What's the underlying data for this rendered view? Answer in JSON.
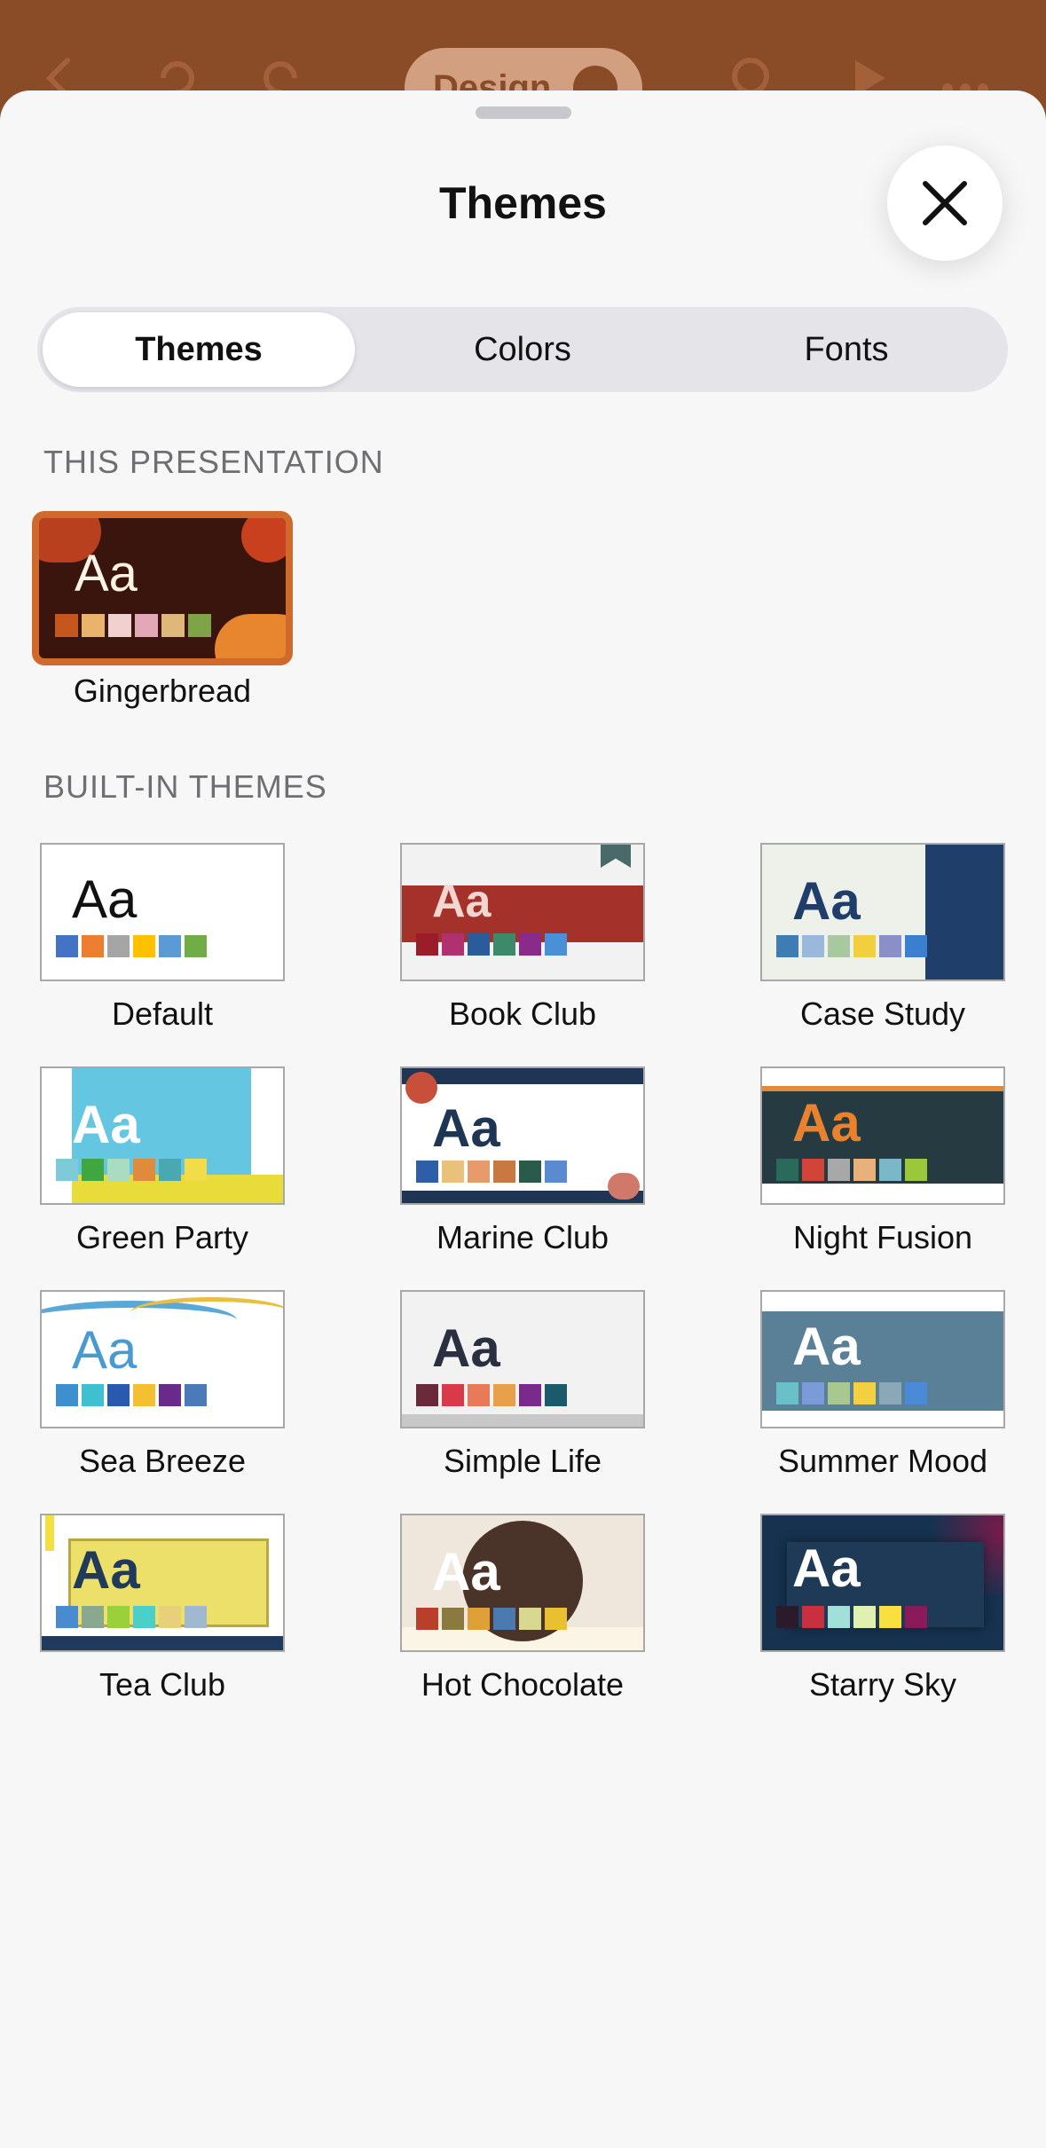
{
  "topbar": {
    "design_label": "Design"
  },
  "sheet": {
    "title": "Themes"
  },
  "segments": [
    "Themes",
    "Colors",
    "Fonts"
  ],
  "sections": {
    "this_presentation": "THIS PRESENTATION",
    "built_in": "BUILT-IN THEMES"
  },
  "current_theme": {
    "name": "Gingerbread",
    "aa": "Aa",
    "swatches": [
      "#c4561e",
      "#e9b36c",
      "#f1d1d0",
      "#e3a8b7",
      "#dfb77a",
      "#7fa447"
    ]
  },
  "themes": [
    {
      "name": "Default",
      "aa": "Aa",
      "swatches": [
        "#4472c4",
        "#ed7d31",
        "#a5a5a5",
        "#ffc000",
        "#5b9bd5",
        "#70ad47"
      ]
    },
    {
      "name": "Book Club",
      "aa": "Aa",
      "swatches": [
        "#9b1d2a",
        "#b03070",
        "#2a5b9b",
        "#3d8a6a",
        "#8a2a8a",
        "#4a90d9"
      ]
    },
    {
      "name": "Case Study",
      "aa": "Aa",
      "swatches": [
        "#3f7cb5",
        "#9ab8dc",
        "#a8c8a0",
        "#f2cf3e",
        "#8a8fc8",
        "#3b7fd0"
      ]
    },
    {
      "name": "Green Party",
      "aa": "Aa",
      "swatches": [
        "#7dcbd8",
        "#3fa640",
        "#a9dcc0",
        "#e08a3c",
        "#4aa8b0",
        "#f2dc4a"
      ]
    },
    {
      "name": "Marine Club",
      "aa": "Aa",
      "swatches": [
        "#2f5ea8",
        "#e8c27a",
        "#e89a6a",
        "#c87840",
        "#2a5a4a",
        "#5a8ad0"
      ]
    },
    {
      "name": "Night Fusion",
      "aa": "Aa",
      "swatches": [
        "#2a6a5a",
        "#d24438",
        "#a8a8a8",
        "#e8b07a",
        "#7ab8c8",
        "#9ac83a"
      ]
    },
    {
      "name": "Sea Breeze",
      "aa": "Aa",
      "swatches": [
        "#3d8fd0",
        "#3fc0d0",
        "#2a5ab0",
        "#f2c030",
        "#6a2a8a",
        "#4a7ab8"
      ]
    },
    {
      "name": "Simple Life",
      "aa": "Aa",
      "swatches": [
        "#6a2a3a",
        "#d83a4a",
        "#e87a5a",
        "#e8a04a",
        "#7a2a8a",
        "#1a5a6a"
      ]
    },
    {
      "name": "Summer Mood",
      "aa": "Aa",
      "swatches": [
        "#6ac0c8",
        "#7a9ad8",
        "#a8c890",
        "#f2d040",
        "#8aa8b8",
        "#4a8ad8"
      ]
    },
    {
      "name": "Tea Club",
      "aa": "Aa",
      "swatches": [
        "#4a8ad0",
        "#8aa890",
        "#9ad03a",
        "#4ad0c8",
        "#e8d07a",
        "#a0b8d0"
      ]
    },
    {
      "name": "Hot Chocolate",
      "aa": "Aa",
      "swatches": [
        "#b8402a",
        "#8a7a40",
        "#e0a038",
        "#4a7ab0",
        "#d8d890",
        "#e8c030"
      ]
    },
    {
      "name": "Starry Sky",
      "aa": "Aa",
      "swatches": [
        "#2a1a2a",
        "#c83040",
        "#a0e0d8",
        "#e0f0b0",
        "#f8e040",
        "#8a1a5a"
      ]
    }
  ]
}
